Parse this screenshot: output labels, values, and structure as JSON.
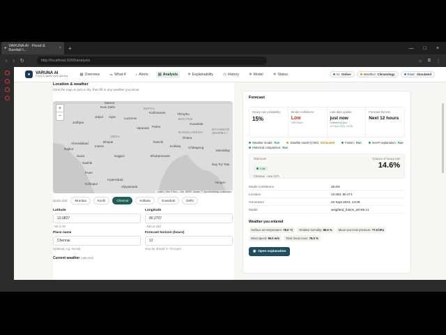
{
  "browser": {
    "tab_title": "VARUNA AI · Flood & Rainfall I...",
    "url": "http://localhost:3000/analysis"
  },
  "app": {
    "brand": "VARUNA AI",
    "tagline": "Flood & rainfall early warning",
    "nav": [
      {
        "label": "Overview",
        "icon": "grid-icon"
      },
      {
        "label": "What-if",
        "icon": "sliders-icon"
      },
      {
        "label": "Alerts",
        "icon": "bell-icon"
      },
      {
        "label": "Analysis",
        "icon": "chart-icon",
        "active": true
      },
      {
        "label": "Explainability",
        "icon": "gear-icon"
      },
      {
        "label": "History",
        "icon": "clock-icon"
      },
      {
        "label": "Model",
        "icon": "cube-icon"
      },
      {
        "label": "Status",
        "icon": "gear-icon"
      }
    ],
    "pills": {
      "ai_label": "AI:",
      "ai_value": "Online",
      "weather_label": "Weather:",
      "weather_value": "Climatology",
      "river_label": "River:",
      "river_value": "Simulated"
    }
  },
  "location": {
    "heading": "Location & weather",
    "subtitle": "Click the map or pick a city, then fill in any weather you know.",
    "map_labels": {
      "meerut": "Meerut",
      "new_delhi": "New Delhi",
      "nepal": "NEPAL",
      "kathmandu": "Kathmandu",
      "thimphu": "Thimphu",
      "bhutan": "BHUTAN",
      "jaipur": "Jaipur",
      "agra": "Agra",
      "lucknow": "Lucknow",
      "jodhpur": "Jodhpur",
      "varanasi": "Varanasi",
      "patna": "Patna",
      "guwahati": "Guwahati",
      "bangladesh": "BANGLADESH",
      "myanmar": "MYANMAR (BURMA)",
      "india": "INDIA",
      "ahmedabad": "Ahmedabad",
      "bhopal": "Bhopal",
      "indore": "Indore",
      "ranchi": "Ranchi",
      "dhaka": "Dhaka",
      "mandalay": "Mandalay",
      "rajkot": "Rajkot",
      "surat": "Surat",
      "nagpur": "Nagpur",
      "kolkata": "Kolkata",
      "chittagong": "Chittagong",
      "nashik": "Nashik",
      "bhubaneswar": "Bhubaneswar",
      "nay_pyi_taw": "Nay Pyi Taw",
      "pune": "Pune",
      "hyderabad": "Hyderabad",
      "yangon": "Yangon",
      "kolhapur": "Kolhapur",
      "vijayawada": "Vijayawada"
    },
    "zoom_in": "+",
    "zoom_out": "−",
    "attribution": "Leaflet | Tiles © Esri — Esri, HERE, Garmin, © OpenStreetMap contributors",
    "quick_pick_label": "Quick pick:",
    "cities": [
      {
        "label": "Mumbai"
      },
      {
        "label": "Kochi"
      },
      {
        "label": "Chennai",
        "selected": true
      },
      {
        "label": "Kolkata"
      },
      {
        "label": "Guwahati"
      },
      {
        "label": "Delhi"
      }
    ],
    "latitude": {
      "label": "Latitude",
      "value": "13.0827",
      "hint": "−90 to 90"
    },
    "longitude": {
      "label": "Longitude",
      "value": "80.2707",
      "hint": "−180 to 180"
    },
    "place": {
      "label": "Place name",
      "value": "Chennai",
      "hint": "Optional, e.g. Kerala"
    },
    "horizon": {
      "label": "Forecast horizon (hours)",
      "value": "12",
      "hint": "How far ahead: 1–72 hours"
    },
    "current_weather": "Current weather",
    "current_weather_opt": "(optional)"
  },
  "forecast": {
    "heading": "Forecast",
    "cells": [
      {
        "label": "Heavy-rain probability",
        "value": "15%",
        "extra": ""
      },
      {
        "label": "Model confidence",
        "value": "Low",
        "extra": "49% score"
      },
      {
        "label": "Last data update",
        "value": "just now",
        "extra": "Entered by you",
        "extra2": "23 Sept 2024, 14:28"
      },
      {
        "label": "Forecast horizon",
        "value": "Next 12 hours",
        "extra": ""
      }
    ],
    "tags": [
      {
        "label": "Weather model:",
        "value": "Ran"
      },
      {
        "label": "Satellite model (CNN):",
        "value": "Estimated"
      },
      {
        "label": "Fusion:",
        "value": "Ran"
      },
      {
        "label": "SHAP explanation:",
        "value": "Ran"
      },
      {
        "label": "Historical comparison:",
        "value": "Ran"
      }
    ],
    "risk": {
      "label": "Risk level",
      "level": "Low",
      "subtitle": "Chennai · next 12 h",
      "chance_label": "Chance of heavy rain",
      "chance_value": "14.6%"
    },
    "kv": [
      {
        "k": "Model confidence",
        "v": "48.8%"
      },
      {
        "k": "Location",
        "v": "13.083, 80.271"
      },
      {
        "k": "Generated",
        "v": "23 Sept 2024, 14:28"
      },
      {
        "k": "Model",
        "v": "weighted_fusion_w0.65-v1"
      }
    ],
    "weather_entered_title": "Weather you entered",
    "chips": [
      {
        "k": "Surface air temperature:",
        "v": "78.0 °C"
      },
      {
        "k": "Relative humidity:",
        "v": "89.0 %"
      },
      {
        "k": "Mean sea-level pressure:",
        "v": "77.0 hPa"
      },
      {
        "k": "Wind speed:",
        "v": "90.0 m/s"
      },
      {
        "k": "Total cloud cover:",
        "v": "78.0 %"
      }
    ],
    "open_button": "Open explanation"
  }
}
